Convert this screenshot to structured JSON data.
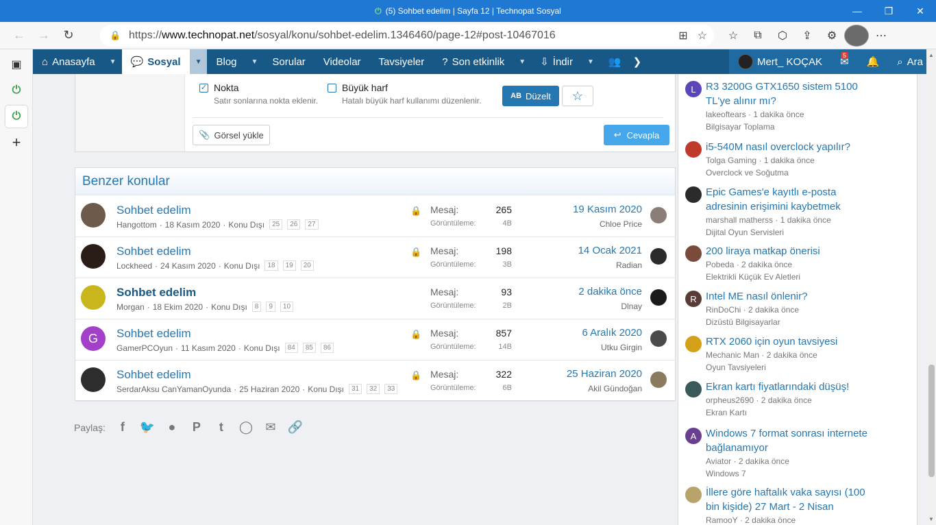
{
  "browser": {
    "tab_title": "(5) Sohbet edelim | Sayfa 12 | Technopat Sosyal",
    "url_prefix": "https://",
    "url_host": "www.technopat.net",
    "url_path": "/sosyal/konu/sohbet-edelim.1346460/page-12#post-10467016"
  },
  "nav": {
    "items": [
      {
        "label": "Anasayfa"
      },
      {
        "label": "Sosyal"
      },
      {
        "label": "Blog"
      },
      {
        "label": "Sorular"
      },
      {
        "label": "Videolar"
      },
      {
        "label": "Tavsiyeler"
      },
      {
        "label": "Son etkinlik"
      },
      {
        "label": "İndir"
      }
    ],
    "username": "Mert_ KOÇAK",
    "inbox_badge": "5",
    "search_label": "Ara"
  },
  "reply": {
    "nokta_label": "Nokta",
    "nokta_desc": "Satır sonlarına nokta eklenir.",
    "buyuk_label": "Büyük harf",
    "buyuk_desc": "Hatalı büyük harf kullanımı düzenlenir.",
    "duzelt_label": "Düzelt",
    "duzelt_icon_text": "AB",
    "gorsel_label": "Görsel yükle",
    "cevapla_label": "Cevapla"
  },
  "similar": {
    "heading": "Benzer konular",
    "msg_label": "Mesaj:",
    "view_label": "Görüntüleme:",
    "rows": [
      {
        "title": "Sohbet edelim",
        "author": "Hangottom",
        "date": "18 Kasım 2020",
        "forum": "Konu Dışı",
        "pages": [
          "25",
          "26",
          "27"
        ],
        "messages": "265",
        "views": "4B",
        "last_date": "19 Kasım 2020",
        "last_user": "Chloe Price",
        "locked": true,
        "bold": false,
        "avatar_letter": "",
        "avatar_color": "#6d5a4a",
        "last_color": "#8b7d77"
      },
      {
        "title": "Sohbet edelim",
        "author": "Lockheed",
        "date": "24 Kasım 2020",
        "forum": "Konu Dışı",
        "pages": [
          "18",
          "19",
          "20"
        ],
        "messages": "198",
        "views": "3B",
        "last_date": "14 Ocak 2021",
        "last_user": "Radian",
        "locked": true,
        "bold": false,
        "avatar_letter": "",
        "avatar_color": "#2a1d17",
        "last_color": "#2b2b2b"
      },
      {
        "title": "Sohbet edelim",
        "author": "Morgan",
        "date": "18 Ekim 2020",
        "forum": "Konu Dışı",
        "pages": [
          "8",
          "9",
          "10"
        ],
        "messages": "93",
        "views": "2B",
        "last_date": "2 dakika önce",
        "last_user": "Dlnay",
        "locked": false,
        "bold": true,
        "avatar_letter": "",
        "avatar_color": "#c9b51c",
        "last_color": "#1a1a1a"
      },
      {
        "title": "Sohbet edelim",
        "author": "GamerPCOyun",
        "date": "11 Kasım 2020",
        "forum": "Konu Dışı",
        "pages": [
          "84",
          "85",
          "86"
        ],
        "messages": "857",
        "views": "14B",
        "last_date": "6 Aralık 2020",
        "last_user": "Utku Girgin",
        "locked": true,
        "bold": false,
        "avatar_letter": "G",
        "avatar_color": "#a33fc9",
        "last_color": "#4a4a4a"
      },
      {
        "title": "Sohbet edelim",
        "author": "SerdarAksu CanYamanOyunda",
        "date": "25 Haziran 2020",
        "forum": "Konu Dışı",
        "pages": [
          "31",
          "32",
          "33"
        ],
        "messages": "322",
        "views": "6B",
        "last_date": "25 Haziran 2020",
        "last_user": "Akil Gündoğan",
        "locked": true,
        "bold": false,
        "avatar_letter": "",
        "avatar_color": "#2d2d2d",
        "last_color": "#8a7a60"
      }
    ]
  },
  "share": {
    "label": "Paylaş:"
  },
  "recent": [
    {
      "title": "R3 3200G GTX1650 sistem 5100 TL'ye alınır mı?",
      "user": "lakeoftears",
      "time": "1 dakika önce",
      "forum": "Bilgisayar Toplama",
      "avatar_letter": "L",
      "avatar_color": "#5c45b8"
    },
    {
      "title": "i5-540M nasıl overclock yapılır?",
      "user": "Tolga Gaming",
      "time": "1 dakika önce",
      "forum": "Overclock ve Soğutma",
      "avatar_letter": "",
      "avatar_color": "#c0392b"
    },
    {
      "title": "Epic Games'e kayıtlı e-posta adresinin erişimini kaybetmek",
      "user": "marshall matherss",
      "time": "1 dakika önce",
      "forum": "Dijital Oyun Servisleri",
      "avatar_letter": "",
      "avatar_color": "#2b2b2b"
    },
    {
      "title": "200 liraya matkap önerisi",
      "user": "Pobeda",
      "time": "2 dakika önce",
      "forum": "Elektrikli Küçük Ev Aletleri",
      "avatar_letter": "",
      "avatar_color": "#7a4a3a"
    },
    {
      "title": "Intel ME nasıl önlenir?",
      "user": "RinDoChi",
      "time": "2 dakika önce",
      "forum": "Dizüstü Bilgisayarlar",
      "avatar_letter": "R",
      "avatar_color": "#5a3c36"
    },
    {
      "title": "RTX 2060 için oyun tavsiyesi",
      "user": "Mechanic Man",
      "time": "2 dakika önce",
      "forum": "Oyun Tavsiyeleri",
      "avatar_letter": "",
      "avatar_color": "#d4a017"
    },
    {
      "title": "Ekran kartı fiyatlarındaki düşüş!",
      "user": "orpheus2690",
      "time": "2 dakika önce",
      "forum": "Ekran Kartı",
      "avatar_letter": "",
      "avatar_color": "#3a5a5a"
    },
    {
      "title": "Windows 7 format sonrası internete bağlanamıyor",
      "user": "Aviator",
      "time": "2 dakika önce",
      "forum": "Windows 7",
      "avatar_letter": "A",
      "avatar_color": "#6a3f8f"
    },
    {
      "title": "İllere göre haftalık vaka sayısı (100 bin kişide) 27 Mart - 2 Nisan",
      "user": "RamooY",
      "time": "2 dakika önce",
      "forum": "",
      "avatar_letter": "",
      "avatar_color": "#b8a36a"
    }
  ]
}
